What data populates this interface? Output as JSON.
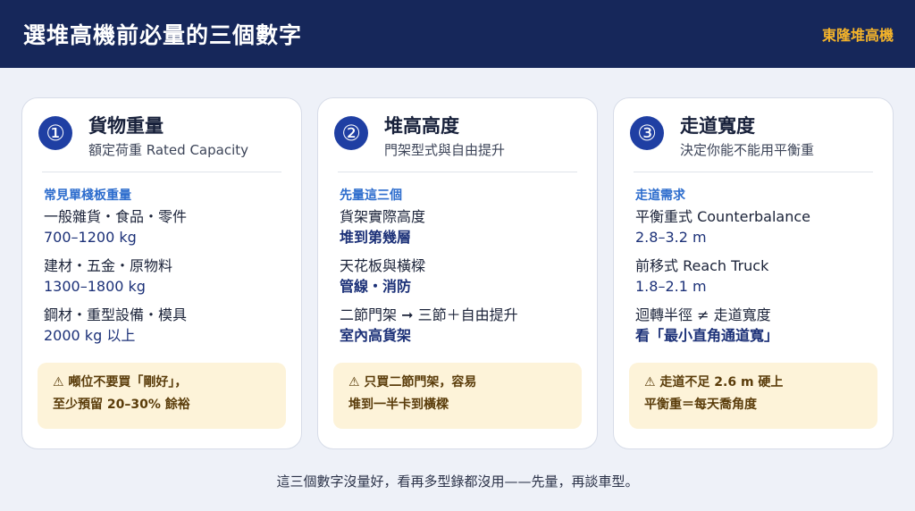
{
  "header": {
    "title": "選堆高機前必量的三個數字",
    "brand": "東隆堆高機"
  },
  "cards": [
    {
      "number": "①",
      "title": "貨物重量",
      "subtitle": "額定荷重 Rated Capacity",
      "section_label": "常見單棧板重量",
      "items": [
        {
          "label": "一般雜貨・食品・零件",
          "value": "700–1200 kg"
        },
        {
          "label": "建材・五金・原物料",
          "value": "1300–1800 kg"
        },
        {
          "label": "鋼材・重型設備・模具",
          "value": "2000 kg 以上"
        }
      ],
      "warning": {
        "line1": "⚠ 噸位不要買「剛好」，",
        "line2": "至少預留 20–30% 餘裕"
      }
    },
    {
      "number": "②",
      "title": "堆高高度",
      "subtitle": "門架型式與自由提升",
      "section_label": "先量這三個",
      "items": [
        {
          "label": "貨架實際高度",
          "value": "堆到第幾層"
        },
        {
          "label": "天花板與橫樑",
          "value": "管線・消防"
        },
        {
          "label": "二節門架 ➞ 三節＋自由提升",
          "value": "室內高貨架"
        }
      ],
      "warning": {
        "line1": "⚠ 只買二節門架，容易",
        "line2": "堆到一半卡到橫樑"
      }
    },
    {
      "number": "③",
      "title": "走道寬度",
      "subtitle": "決定你能不能用平衡重",
      "section_label": "走道需求",
      "items": [
        {
          "label": "平衡重式 Counterbalance",
          "value": "2.8–3.2 m"
        },
        {
          "label": "前移式 Reach Truck",
          "value": "1.8–2.1 m"
        },
        {
          "label": "迴轉半徑 ≠ 走道寬度",
          "value": "看「最小直角通道寬」"
        }
      ],
      "warning": {
        "line1": "⚠ 走道不足 2.6 m 硬上",
        "line2": "平衡重＝每天喬角度"
      }
    }
  ],
  "footer": {
    "text": "這三個數字沒量好，看再多型錄都沒用——先量，再談車型。"
  },
  "colors": {
    "header_bg": "#16275a",
    "accent": "#f5b42a",
    "number_badge": "#1f3fa3",
    "section_label": "#2c6ccd",
    "value_text": "#1c3178",
    "warning_bg": "#fdf3d9"
  }
}
